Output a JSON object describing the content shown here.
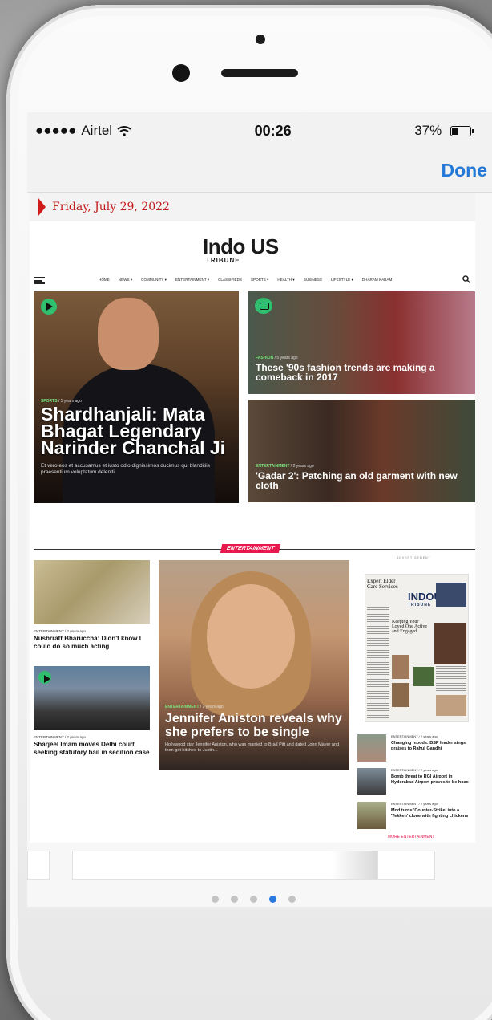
{
  "status": {
    "signal_dots": "●●●●●",
    "carrier": "Airtel",
    "wifi_icon": "wifi-icon",
    "time": "00:26",
    "battery_percent": "37%",
    "battery_level": 0.37
  },
  "toolbar": {
    "done_label": "Done"
  },
  "page": {
    "date": "Friday, July 29, 2022",
    "logo_main": "Indo US",
    "logo_sub": "TRIBUNE",
    "nav": [
      "HOME",
      "NEWS ▾",
      "COMMUNITY ▾",
      "ENTERTAINMENT ▾",
      "CLASSIFIEDS",
      "SPORTS ▾",
      "HEALTH ▾",
      "BUSINESS",
      "LIFESTYLE ▾",
      "DHARAM KARAM"
    ],
    "featured": {
      "category": "SPORTS",
      "age": "/ 5 years ago",
      "title": "Shardhanjali: Mata Bhagat Legendary Narinder Chanchal Ji",
      "excerpt": "Et vero eos et accusamus et iusto odio dignissimos ducimus qui blanditiis praesentium voluptatum deleniti."
    },
    "story2": {
      "category": "FASHION",
      "age": "/ 5 years ago",
      "title": "These '90s fashion trends are making a comeback in 2017"
    },
    "story3": {
      "category": "ENTERTAINMENT",
      "age": "/ 2 years ago",
      "title": "'Gadar 2': Patching an old garment with new cloth"
    },
    "section_label": "ENTERTAINMENT",
    "small1": {
      "meta": "ENTERTAINMENT / 2 years ago",
      "title": "Nushrratt Bharuccha: Didn't know I could do so much acting"
    },
    "small2": {
      "meta": "ENTERTAINMENT / 2 years ago",
      "title": "Sharjeel Imam moves Delhi court seeking statutory bail in sedition case"
    },
    "big": {
      "category": "ENTERTAINMENT",
      "age": "/ 2 years ago",
      "title": "Jennifer Aniston reveals why she prefers to be single",
      "excerpt": "Hollywood star Jennifer Aniston, who was married to Brad Pitt and dated John Mayer and then got hitched to Justin..."
    },
    "ad_label": "ADVERTISEMENT",
    "ad_logo": "INDOUS",
    "ad_logo_sub": "TRIBUNE",
    "ad_headline": "Expert Elder Care Services",
    "ad_headline2": "Keeping Your Loved One Active and Engaged",
    "list": [
      {
        "meta": "ENTERTAINMENT / 2 years ago",
        "title": "Changing moods: BSP leader sings praises to Rahul Gandhi"
      },
      {
        "meta": "ENTERTAINMENT / 2 years ago",
        "title": "Bomb threat to RGI Airport in Hyderabad Airport proves to be hoax"
      },
      {
        "meta": "ENTERTAINMENT / 2 years ago",
        "title": "Mod turns 'Counter-Strike' into a 'Tekken' clone with fighting chickens"
      }
    ],
    "more_label": "MORE ENTERTAINMENT"
  },
  "pager": {
    "count": 5,
    "active_index": 3
  },
  "colors": {
    "accent": "#2479d6",
    "section": "#e8174d",
    "category": "#7be37b",
    "date": "#c11a1a"
  }
}
